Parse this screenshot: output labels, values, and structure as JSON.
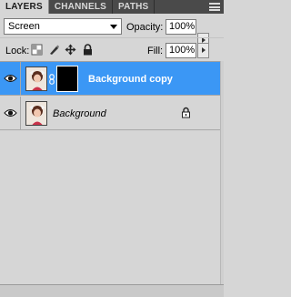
{
  "tabs": [
    {
      "label": "LAYERS",
      "active": true
    },
    {
      "label": "CHANNELS",
      "active": false
    },
    {
      "label": "PATHS",
      "active": false
    }
  ],
  "blend_mode": {
    "value": "Screen"
  },
  "opacity": {
    "label": "Opacity:",
    "value": "100%"
  },
  "lock": {
    "label": "Lock:",
    "icons": [
      "lock-transparent-pixels-icon",
      "lock-image-pixels-icon",
      "lock-position-icon",
      "lock-all-icon"
    ]
  },
  "fill": {
    "label": "Fill:",
    "value": "100%"
  },
  "layers": [
    {
      "name": "Background copy",
      "selected": true,
      "visible": true,
      "has_mask": true,
      "locked": false
    },
    {
      "name": "Background",
      "selected": false,
      "visible": true,
      "has_mask": false,
      "locked": true
    }
  ],
  "colors": {
    "selected": "#3b97f5",
    "panel": "#d6d6d6",
    "tabbar": "#4a4a4a"
  }
}
